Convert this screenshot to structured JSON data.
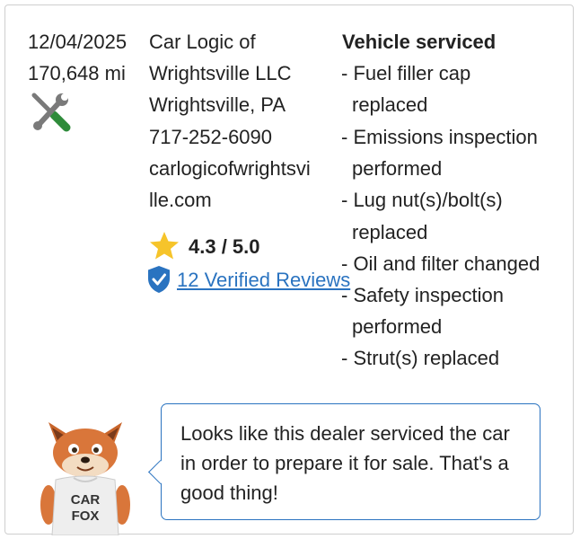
{
  "record": {
    "date": "12/04/2025",
    "mileage": "170,648 mi",
    "icon": "wrench-screwdriver-icon",
    "dealer": {
      "name_line1": "Car Logic of",
      "name_line2": "Wrightsville LLC",
      "location": "Wrightsville, PA",
      "phone": "717-252-6090",
      "website_line1": "carlogicofwrightsvi",
      "website_line2": "lle.com",
      "rating": "4.3 / 5.0",
      "reviews_link": "12 Verified Reviews"
    },
    "services": {
      "title": "Vehicle serviced",
      "lines": [
        "- Fuel filler cap",
        "replaced",
        "- Emissions inspection",
        "performed",
        "- Lug nut(s)/bolt(s)",
        "replaced",
        "- Oil and filter changed",
        "- Safety inspection",
        "performed",
        "- Strut(s) replaced"
      ]
    }
  },
  "carfox": {
    "shirt_line1": "CAR",
    "shirt_line2": "FOX",
    "message": "Looks like this dealer serviced the car in order to prepare it for sale. That's a good thing!"
  },
  "colors": {
    "link": "#2a73c0",
    "star": "#f6c42a",
    "wrench_green": "#2e8b3a",
    "border": "#cfcfcf"
  }
}
